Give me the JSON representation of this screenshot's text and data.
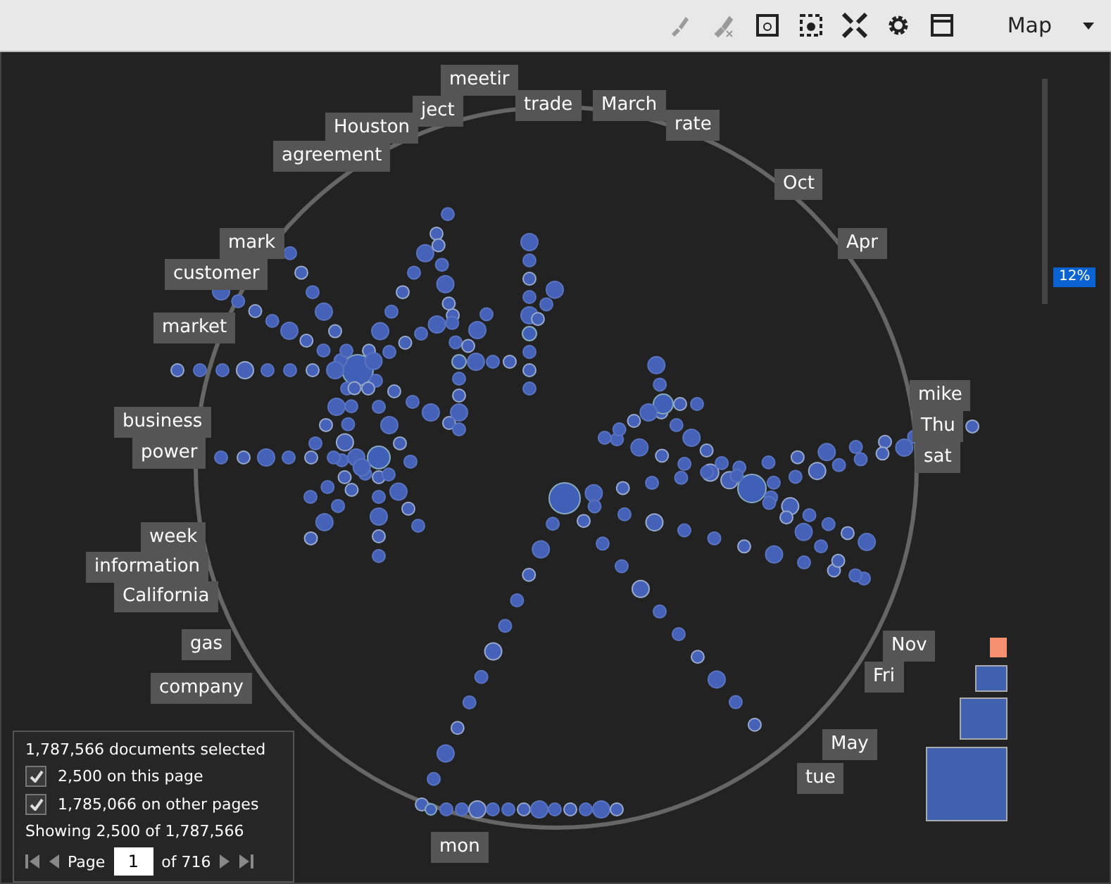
{
  "toolbar": {
    "tools": [
      {
        "kind": "brush",
        "disabled": true
      },
      {
        "kind": "brush-x",
        "disabled": true
      },
      {
        "kind": "select-box",
        "disabled": false
      },
      {
        "kind": "select-dashed",
        "disabled": false
      },
      {
        "kind": "fit",
        "disabled": false
      },
      {
        "kind": "settings",
        "disabled": false
      },
      {
        "kind": "window",
        "disabled": false
      }
    ],
    "view": "Map"
  },
  "terms": [
    "agreement",
    "Houston",
    "ject",
    "meetir",
    "trade",
    "March",
    "rate",
    "Oct",
    "Apr",
    "mike",
    "Thu",
    "sat",
    "mark",
    "customer",
    "market",
    "business",
    "power",
    "week",
    "information",
    "California",
    "gas",
    "company",
    "Nov",
    "Fri",
    "May",
    "tue",
    "mon"
  ],
  "zoom": {
    "level": 0.12,
    "reading": "12%"
  },
  "selection": {
    "summary": "1,787,566 documents selected",
    "options": [
      {
        "label": "2,500 on this page",
        "checked": true
      },
      {
        "label": "1,785,066 on other pages",
        "checked": true
      }
    ],
    "showing": "Showing 2,500 of 1,787,566",
    "page_label": "Page",
    "page": "1",
    "page_total": "of 716"
  }
}
